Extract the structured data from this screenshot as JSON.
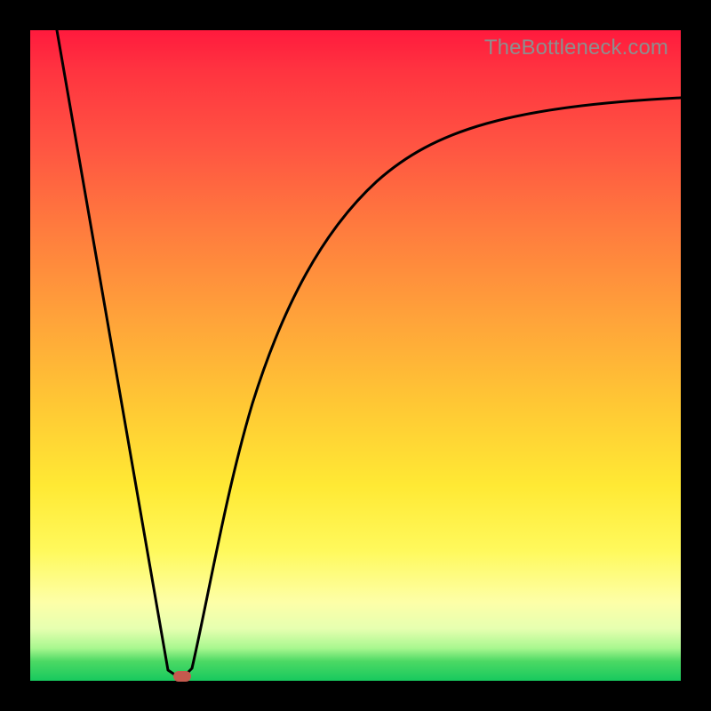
{
  "watermark": "TheBottleneck.com",
  "colors": {
    "frame": "#000000",
    "gradient_top": "#ff1a3d",
    "gradient_bottom": "#17c95e",
    "curve": "#000000",
    "marker": "#c55a4e",
    "watermark_text": "#8e8e8e"
  },
  "chart_data": {
    "type": "line",
    "title": "",
    "xlabel": "",
    "ylabel": "",
    "xlim": [
      0,
      100
    ],
    "ylim": [
      0,
      100
    ],
    "grid": false,
    "series": [
      {
        "name": "left-slope",
        "x": [
          4,
          20,
          23
        ],
        "values": [
          100,
          13,
          0
        ]
      },
      {
        "name": "right-curve",
        "x": [
          23,
          25,
          27,
          30,
          33,
          37,
          42,
          48,
          55,
          63,
          72,
          82,
          100
        ],
        "values": [
          0,
          10,
          22,
          35,
          46,
          56,
          65,
          72,
          78,
          82,
          85,
          87,
          89
        ]
      }
    ],
    "annotations": [
      {
        "name": "min-marker",
        "x": 23,
        "y": 0,
        "shape": "rounded-rect"
      }
    ]
  }
}
